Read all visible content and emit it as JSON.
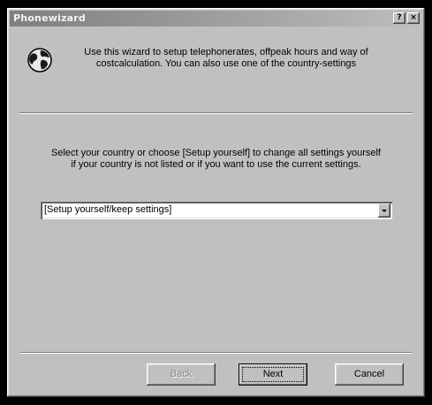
{
  "window": {
    "title": "Phonewizard",
    "help_glyph": "?",
    "close_glyph": "×"
  },
  "intro": {
    "icon": "globe-icon",
    "line1": "Use this wizard to setup telephonerates, offpeak hours and way of",
    "line2": "costcalculation. You can also use one of the country-settings"
  },
  "instructions": {
    "line1": "Select your country or choose [Setup yourself] to change all settings yourself",
    "line2": "if your country is not listed or if you want to use the current settings."
  },
  "country_select": {
    "value": "[Setup yourself/keep settings]"
  },
  "buttons": {
    "back": "Back",
    "next": "Next",
    "cancel": "Cancel"
  },
  "colors": {
    "face": "#c0c0c0",
    "titlebar": "#7f7f7f",
    "background": "#000000"
  }
}
